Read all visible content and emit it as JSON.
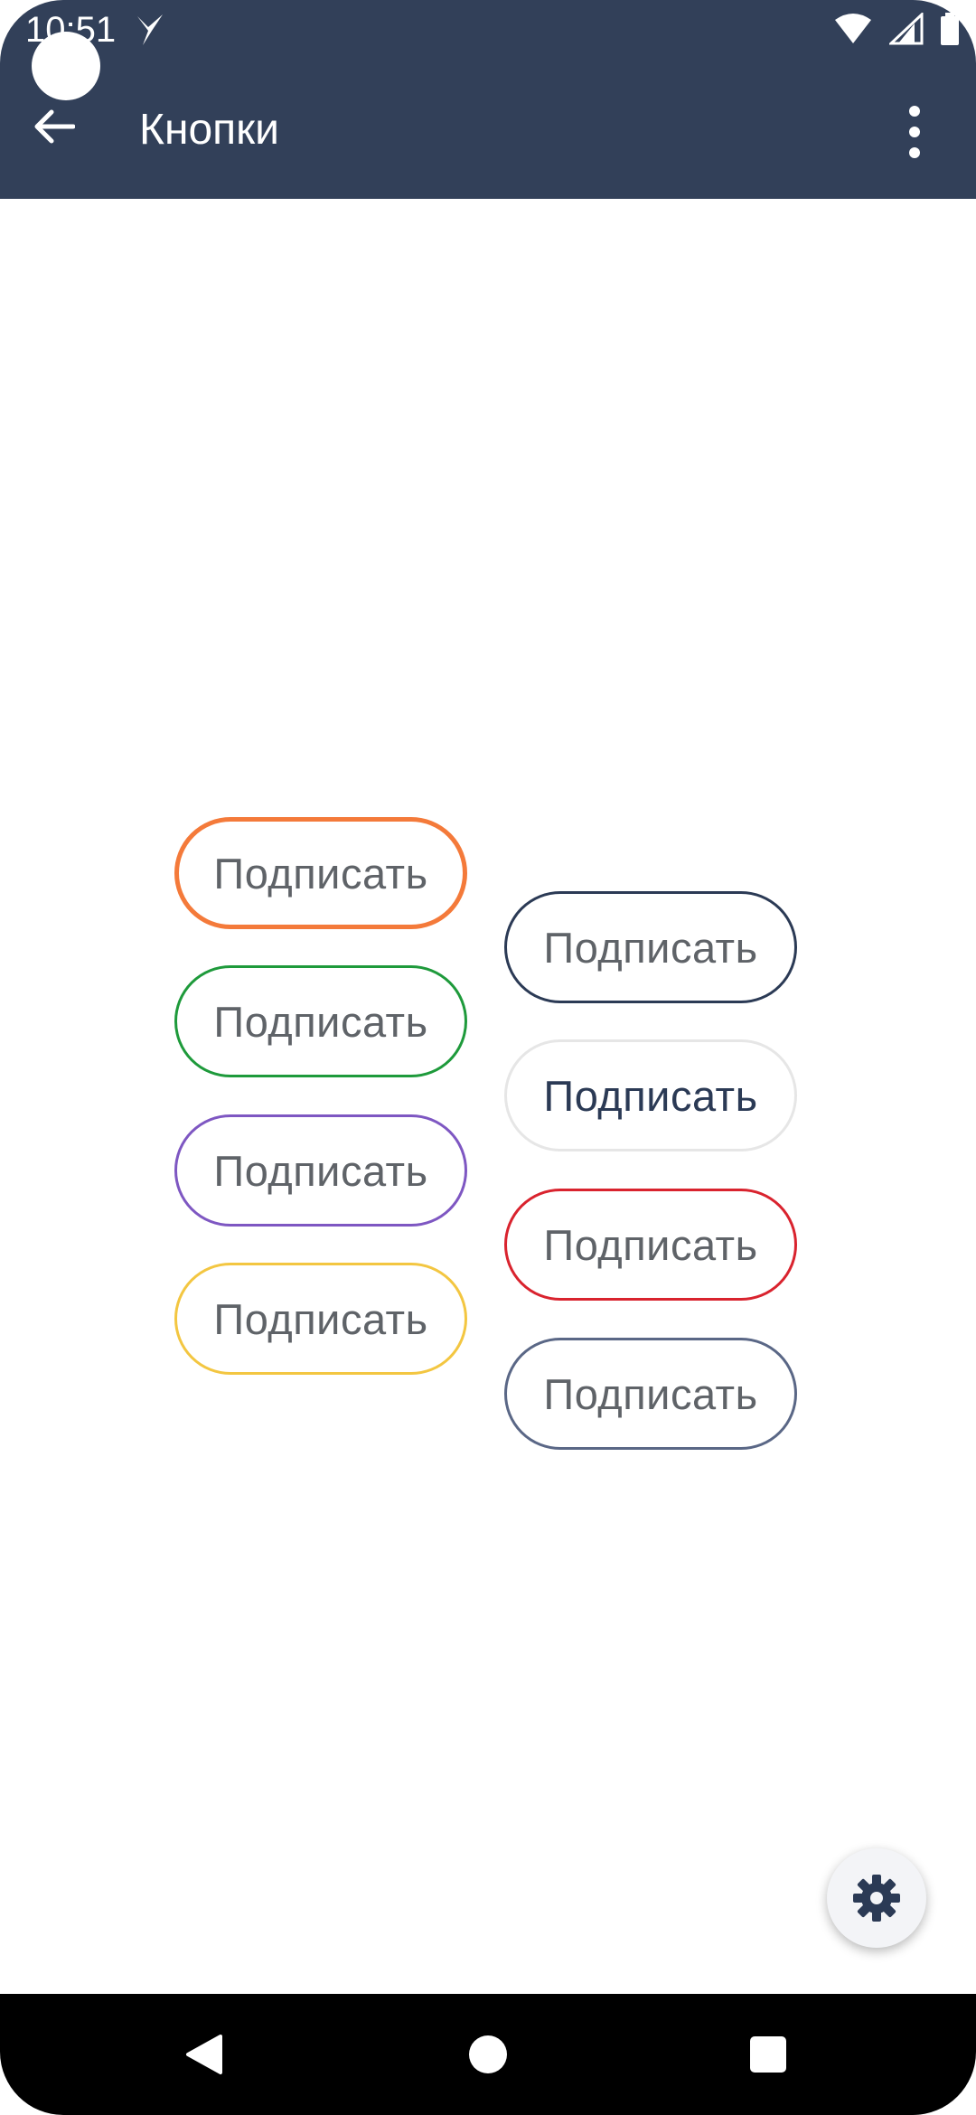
{
  "status_bar": {
    "time": "10:51",
    "icons": [
      "bird-notification-icon",
      "wifi-icon",
      "signal-icon",
      "battery-icon"
    ]
  },
  "app_bar": {
    "title": "Кнопки",
    "back_icon": "arrow-left-icon",
    "menu_icon": "more-vertical-icon",
    "background": "#324059"
  },
  "buttons": {
    "left": [
      {
        "label": "Подписать",
        "border_color": "#F47A3A"
      },
      {
        "label": "Подписать",
        "border_color": "#1E9A3B"
      },
      {
        "label": "Подписать",
        "border_color": "#7E57C2"
      },
      {
        "label": "Подписать",
        "border_color": "#F3C641"
      }
    ],
    "right": [
      {
        "label": "Подписать",
        "border_color": "#2B3A55"
      },
      {
        "label": "Подписать",
        "border_color": "#E6E6E6",
        "text_color": "#2B3A55"
      },
      {
        "label": "Подписать",
        "border_color": "#D9232E"
      },
      {
        "label": "Подписать",
        "border_color": "#5A6786"
      }
    ]
  },
  "fab": {
    "icon": "gear-icon",
    "icon_color": "#2B3A55"
  },
  "nav_bar": {
    "icons": [
      "back-triangle-icon",
      "home-circle-icon",
      "recents-square-icon"
    ]
  }
}
